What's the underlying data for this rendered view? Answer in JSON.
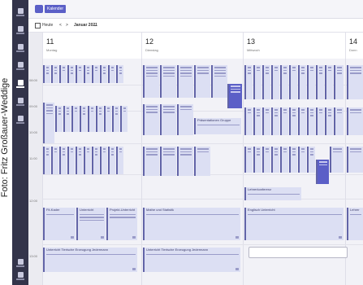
{
  "credit": "Foto: Fritz Großauer-Weddige",
  "header": {
    "app_title": "Kalender"
  },
  "toolbar": {
    "today": "Heute",
    "prev": "<",
    "next": ">",
    "month": "Januar 2021",
    "chevron": "⌄"
  },
  "days": [
    {
      "num": "11",
      "weekday": "Montag"
    },
    {
      "num": "12",
      "weekday": "Dienstag"
    },
    {
      "num": "13",
      "weekday": "Mittwoch"
    },
    {
      "num": "14",
      "weekday": "Donn"
    }
  ],
  "times": [
    "08:00",
    "09:00",
    "10:00",
    "11:00",
    "12:00",
    "13:00"
  ],
  "events": {
    "e_a": "Fit-Kader",
    "e_b": "Unterricht",
    "e_c": "Unterricht",
    "e_d": "Projekt-Unterricht",
    "e_e": "Unterricht Tierische Erzeugung Jedermann",
    "e_f": "Unterricht Tierische Erzeugung Jedermann",
    "e_g": "Mathe und Statistik",
    "e_h": "Präsentationen Gruppe",
    "e_i": "Lehrerkonferenz",
    "e_j": "Englisch Unterricht",
    "e_k": "Lehrer"
  }
}
